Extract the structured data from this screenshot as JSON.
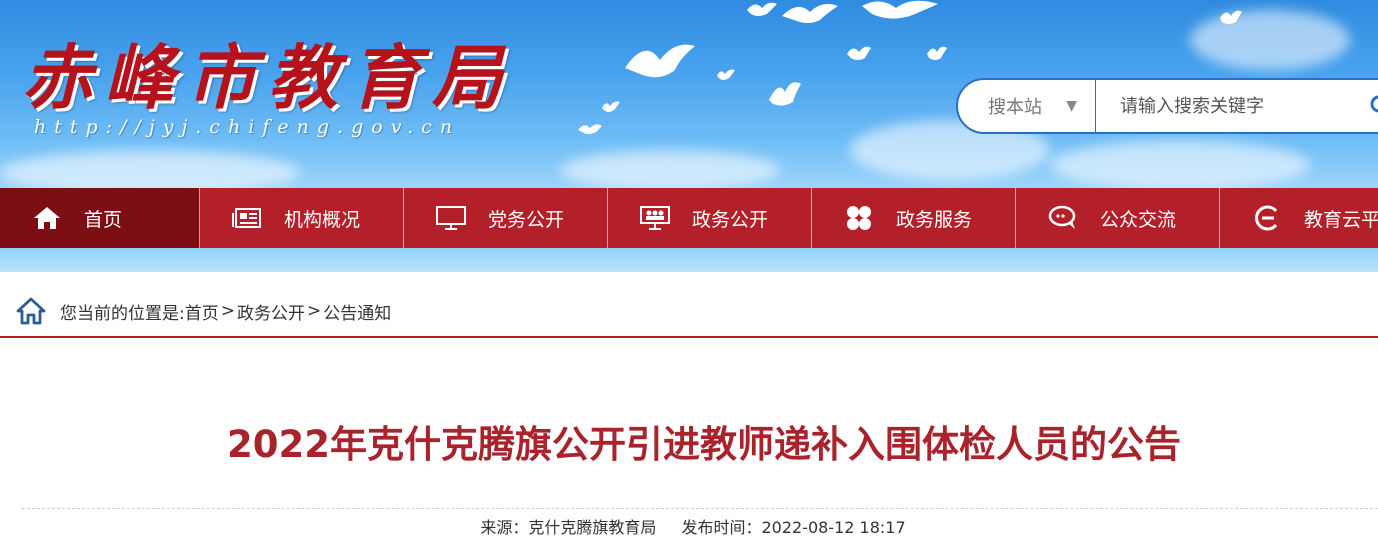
{
  "header": {
    "site_title": "赤峰市教育局",
    "site_url": "http://jyj.chifeng.gov.cn"
  },
  "search": {
    "scope_label": "搜本站",
    "scope_arrow": "▼",
    "placeholder": "请输入搜索关键字",
    "icon": "search-icon"
  },
  "nav": {
    "items": [
      {
        "label": "首页",
        "icon": "home-icon"
      },
      {
        "label": "机构概况",
        "icon": "newspaper-icon"
      },
      {
        "label": "党务公开",
        "icon": "monitor-icon"
      },
      {
        "label": "政务公开",
        "icon": "people-board-icon"
      },
      {
        "label": "政务服务",
        "icon": "grid-icon"
      },
      {
        "label": "公众交流",
        "icon": "chat-icon"
      },
      {
        "label": "教育云平",
        "icon": "cloud-e-icon"
      }
    ]
  },
  "breadcrumb": {
    "prefix": "您当前的位置是:",
    "items": [
      "首页",
      "政务公开",
      "公告通知"
    ],
    "separator": ">"
  },
  "article": {
    "title": "2022年克什克腾旗公开引进教师递补入围体检人员的公告",
    "source": "来源：克什克腾旗教育局",
    "published": "发布时间：2022-08-12 18:17"
  },
  "colors": {
    "brand_red": "#b3202a",
    "nav_active": "#7d0e14",
    "title_red": "#a8232b",
    "search_border": "#2a6fc4"
  }
}
